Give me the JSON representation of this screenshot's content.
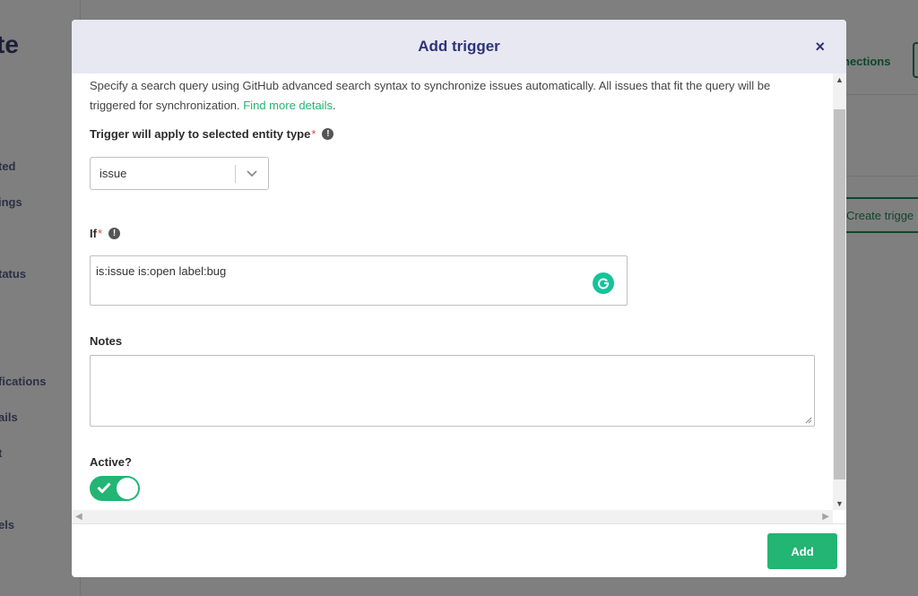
{
  "background": {
    "logo_text": "te",
    "nav_items": [
      "ted",
      "ings",
      "",
      "tatus",
      "fications",
      "ails",
      "t",
      "els"
    ],
    "connections_label": "nections",
    "create_trigger_label": "Create trigge"
  },
  "modal": {
    "title": "Add trigger",
    "close_icon": "×",
    "intro_text": "Specify a search query using GitHub advanced search syntax to synchronize issues automatically. All issues that fit the query will be triggered for synchronization.",
    "intro_link": "Find more details",
    "entity_type": {
      "label": "Trigger will apply to selected entity type",
      "required_mark": "*",
      "selected_value": "issue"
    },
    "if_field": {
      "label": "If",
      "required_mark": "*",
      "value": "is:issue is:open label:bug"
    },
    "notes_field": {
      "label": "Notes",
      "value": ""
    },
    "active": {
      "label": "Active?",
      "checked": true
    },
    "add_button_label": "Add"
  },
  "colors": {
    "accent_green": "#22b573",
    "title_navy": "#2e3378",
    "header_bg": "#e7e8f2",
    "required_red": "#e04a3a"
  }
}
